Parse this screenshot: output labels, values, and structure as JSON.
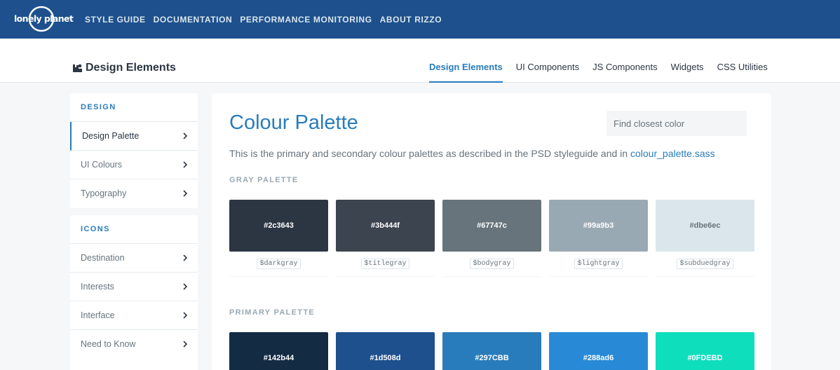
{
  "topbar": {
    "logo_text": "lonely planet",
    "nav": [
      "STYLE GUIDE",
      "DOCUMENTATION",
      "PERFORMANCE MONITORING",
      "ABOUT RIZZO"
    ]
  },
  "subheader": {
    "title": "Design Elements",
    "tabs": [
      "Design Elements",
      "UI Components",
      "JS Components",
      "Widgets",
      "CSS Utilities"
    ],
    "active_tab": "Design Elements"
  },
  "sidebar": {
    "design": {
      "heading": "DESIGN",
      "items": [
        "Design Palette",
        "UI Colours",
        "Typography"
      ]
    },
    "icons": {
      "heading": "ICONS",
      "items": [
        "Destination",
        "Interests",
        "Interface",
        "Need to Know"
      ]
    }
  },
  "main": {
    "title": "Colour Palette",
    "search_placeholder": "Find closest color",
    "description": "This is the primary and secondary colour palettes as described in the PSD styleguide and in ",
    "description_link": "colour_palette.sass",
    "gray": {
      "label": "GRAY PALETTE",
      "swatches": [
        {
          "hex": "#2c3643",
          "var": "$darkgray"
        },
        {
          "hex": "#3b444f",
          "var": "$titlegray"
        },
        {
          "hex": "#67747c",
          "var": "$bodygray"
        },
        {
          "hex": "#99a9b3",
          "var": "$lightgray"
        },
        {
          "hex": "#dbe6ec",
          "var": "$subduedgray"
        }
      ]
    },
    "primary": {
      "label": "PRIMARY PALETTE",
      "swatches": [
        {
          "hex": "#142b44"
        },
        {
          "hex": "#1d508d"
        },
        {
          "hex": "#297CBB"
        },
        {
          "hex": "#288ad6"
        },
        {
          "hex": "#0FDEBD"
        }
      ]
    }
  },
  "colors": {
    "brand_blue": "#1d508d",
    "accent": "#297cbb"
  }
}
